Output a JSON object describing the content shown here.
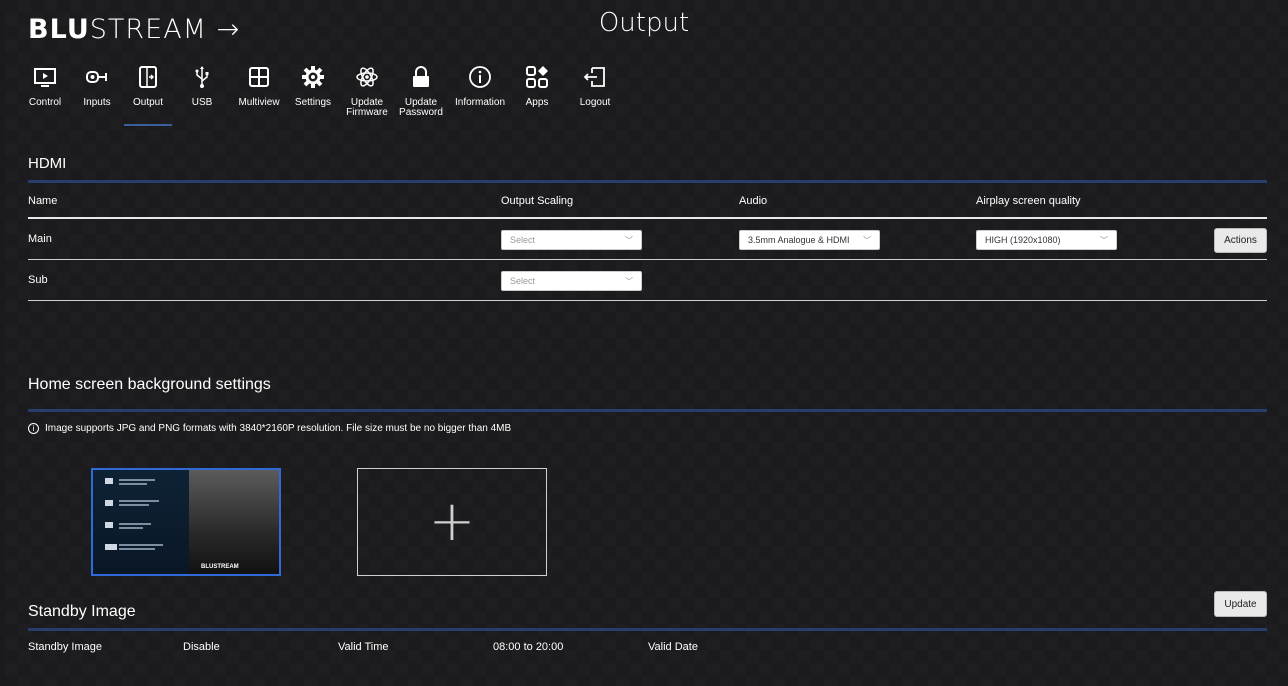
{
  "logo": {
    "bold": "BLU",
    "light": "STREAM",
    "arrow": "→"
  },
  "page_title": "Output",
  "nav": [
    {
      "label": "Control",
      "icon": "monitor-play-icon"
    },
    {
      "label": "Inputs",
      "icon": "input-connector-icon"
    },
    {
      "label": "Output",
      "icon": "output-icon",
      "active": true
    },
    {
      "label": "USB",
      "icon": "usb-icon"
    },
    {
      "label": "Multiview",
      "icon": "multiview-grid-icon"
    },
    {
      "label": "Settings",
      "icon": "gear-icon"
    },
    {
      "label": "Update\nFirmware",
      "icon": "atom-icon"
    },
    {
      "label": "Update\nPassword",
      "icon": "lock-icon"
    },
    {
      "label": "Information",
      "icon": "info-icon"
    },
    {
      "label": "Apps",
      "icon": "apps-icon"
    },
    {
      "label": "Logout",
      "icon": "logout-icon"
    }
  ],
  "hdmi": {
    "title": "HDMI",
    "columns": {
      "name": "Name",
      "scaling": "Output Scaling",
      "audio": "Audio",
      "airplay": "Airplay screen quality"
    },
    "rows": [
      {
        "name": "Main",
        "scaling": "Select",
        "audio": "3.5mm Analogue & HDMI",
        "airplay": "HIGH (1920x1080)",
        "action": "Actions"
      },
      {
        "name": "Sub",
        "scaling": "Select"
      }
    ]
  },
  "home_bg": {
    "title": "Home screen background settings",
    "info": "Image supports JPG and PNG formats with 3840*2160P resolution. File size must be no bigger than 4MB",
    "add_label": "+",
    "thumb_logo": "BLUSTREAM"
  },
  "standby": {
    "title": "Standby Image",
    "update_label": "Update",
    "label": "Standby Image",
    "value": "Disable",
    "time_label": "Valid Time",
    "time_value": "08:00 to 20:00",
    "date_label": "Valid Date"
  },
  "colors": {
    "accent_line": "#253e6b",
    "selected_border": "#2f6ad8",
    "background": "#1b1b1d"
  }
}
